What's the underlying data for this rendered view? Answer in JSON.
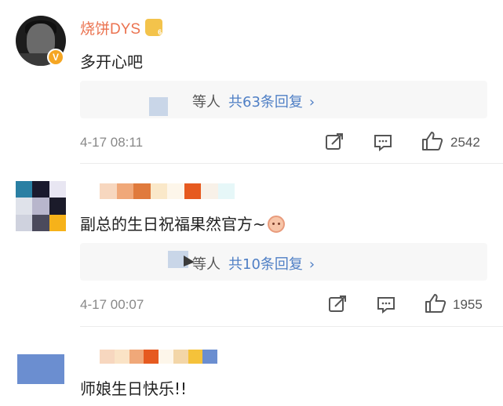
{
  "comments": [
    {
      "username": "烧饼DYS",
      "text": "多开心吧",
      "reply": {
        "who": "等人",
        "count": "共63条回复",
        "chevron": "›"
      },
      "time": "4-17 08:11",
      "likes": "2542"
    },
    {
      "username": "",
      "text": "副总的生日祝福果然官方~",
      "reply": {
        "who": "等人",
        "count": "共10条回复",
        "chevron": "›"
      },
      "time": "4-17 00:07",
      "likes": "1955"
    },
    {
      "username": "",
      "text": "师娘生日快乐!!"
    }
  ],
  "icons": {
    "repost": "repost-icon",
    "comment": "comment-icon",
    "like": "like-icon",
    "verified": "verified-badge-icon",
    "level": "level-badge-icon"
  },
  "colors": {
    "username": "#eb7350",
    "link": "#4f7fc5",
    "muted": "#888888",
    "reply_bg": "#f7f7f7"
  }
}
